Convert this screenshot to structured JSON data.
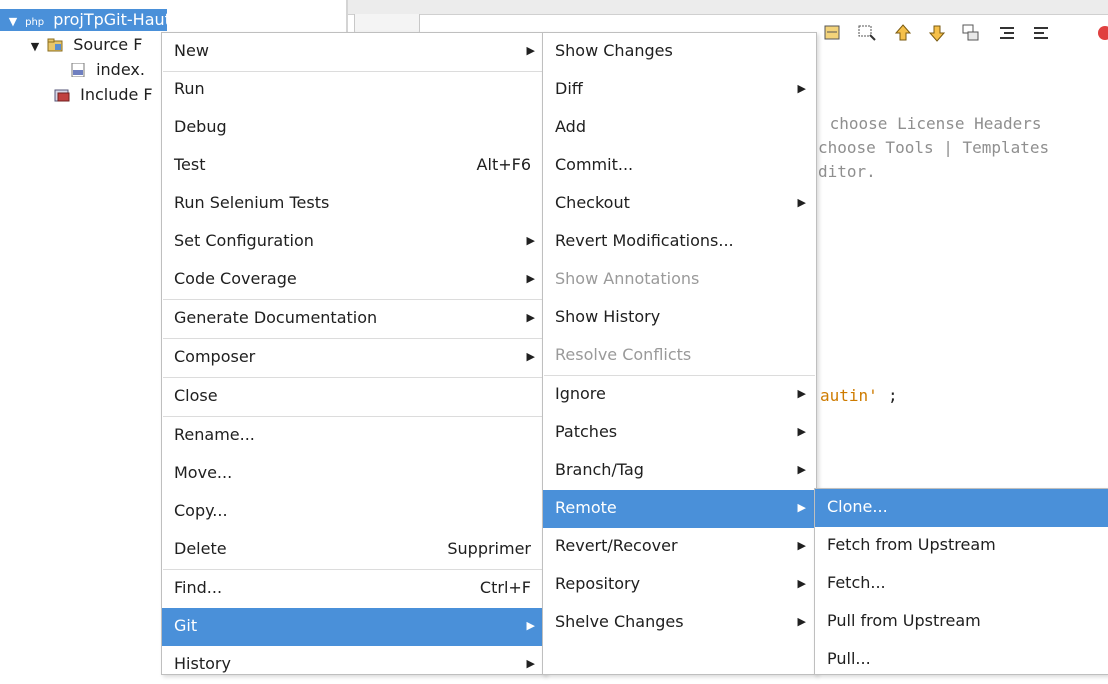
{
  "project_tree": {
    "root": "projTpGit-Hautin",
    "root_prefix": "php",
    "source_files": "Source F",
    "index_file": "index.",
    "include_path": "Include F"
  },
  "editor": {
    "comment_line1": " choose License Headers",
    "comment_line2": "choose Tools | Templates",
    "comment_line3": "ditor.",
    "string_fragment": "autin'",
    "semicolon": ";"
  },
  "context_menu": {
    "items": [
      {
        "label": "New",
        "submenu": true
      },
      {
        "label": "Run"
      },
      {
        "label": "Debug"
      },
      {
        "label": "Test",
        "shortcut": "Alt+F6"
      },
      {
        "label": "Run Selenium Tests"
      },
      {
        "label": "Set Configuration",
        "submenu": true
      },
      {
        "label": "Code Coverage",
        "submenu": true
      },
      {
        "label": "Generate Documentation",
        "submenu": true
      },
      {
        "label": "Composer",
        "submenu": true
      },
      {
        "label": "Close"
      },
      {
        "label": "Rename..."
      },
      {
        "label": "Move..."
      },
      {
        "label": "Copy..."
      },
      {
        "label": "Delete",
        "shortcut": "Supprimer"
      },
      {
        "label": "Find...",
        "shortcut": "Ctrl+F"
      },
      {
        "label": "Git",
        "submenu": true,
        "selected": true
      },
      {
        "label": "History",
        "submenu": true
      }
    ]
  },
  "git_menu": {
    "items": [
      {
        "label": "Show Changes"
      },
      {
        "label": "Diff",
        "submenu": true
      },
      {
        "label": "Add"
      },
      {
        "label": "Commit..."
      },
      {
        "label": "Checkout",
        "submenu": true
      },
      {
        "label": "Revert Modifications..."
      },
      {
        "label": "Show Annotations",
        "disabled": true
      },
      {
        "label": "Show History"
      },
      {
        "label": "Resolve Conflicts",
        "disabled": true
      },
      {
        "label": "Ignore",
        "submenu": true
      },
      {
        "label": "Patches",
        "submenu": true
      },
      {
        "label": "Branch/Tag",
        "submenu": true
      },
      {
        "label": "Remote",
        "submenu": true,
        "selected": true
      },
      {
        "label": "Revert/Recover",
        "submenu": true
      },
      {
        "label": "Repository",
        "submenu": true
      },
      {
        "label": "Shelve Changes",
        "submenu": true
      }
    ]
  },
  "remote_menu": {
    "items": [
      {
        "label": "Clone...",
        "selected": true
      },
      {
        "label": "Fetch from Upstream"
      },
      {
        "label": "Fetch..."
      },
      {
        "label": "Pull from Upstream"
      },
      {
        "label": "Pull..."
      }
    ]
  },
  "colors": {
    "selection": "#4a90d9",
    "menu_border": "#bfbfbf",
    "disabled_text": "#9a9a9a"
  },
  "icons": {
    "submenu_arrow": "▶"
  }
}
